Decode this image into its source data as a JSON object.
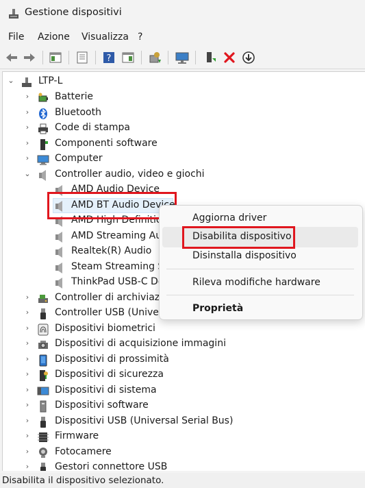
{
  "window": {
    "title": "Gestione dispositivi"
  },
  "menu": [
    "File",
    "Azione",
    "Visualizza",
    "?"
  ],
  "toolbar": {
    "buttons": [
      "back-arrow-icon",
      "forward-arrow-icon",
      "show-hide-console-tree-icon",
      "properties-icon",
      "help-icon",
      "action-pane-icon",
      "update-driver-icon",
      "scan-hardware-icon",
      "add-device-icon",
      "uninstall-device-icon",
      "disable-device-icon"
    ]
  },
  "tree": {
    "root": "LTP-L",
    "categories": [
      {
        "label": "Batterie",
        "icon": "battery-icon",
        "expanded": false
      },
      {
        "label": "Bluetooth",
        "icon": "bluetooth-icon",
        "expanded": false
      },
      {
        "label": "Code di stampa",
        "icon": "printer-icon",
        "expanded": false
      },
      {
        "label": "Componenti software",
        "icon": "software-component-icon",
        "expanded": false
      },
      {
        "label": "Computer",
        "icon": "computer-icon",
        "expanded": false
      },
      {
        "label": "Controller audio, video e giochi",
        "icon": "speaker-icon",
        "expanded": true,
        "children": [
          {
            "label": "AMD Audio Device",
            "icon": "speaker-icon"
          },
          {
            "label": "AMD BT Audio Device",
            "icon": "speaker-icon",
            "selected": true
          },
          {
            "label": "AMD High Definition",
            "icon": "speaker-icon"
          },
          {
            "label": "AMD Streaming Aud",
            "icon": "speaker-icon"
          },
          {
            "label": "Realtek(R) Audio",
            "icon": "speaker-icon"
          },
          {
            "label": "Steam Streaming Sp",
            "icon": "speaker-icon"
          },
          {
            "label": "ThinkPad USB-C Doc",
            "icon": "speaker-icon"
          }
        ]
      },
      {
        "label": "Controller di archiviazio",
        "icon": "storage-controller-icon",
        "expanded": false
      },
      {
        "label": "Controller USB (Universa",
        "icon": "usb-icon",
        "expanded": false
      },
      {
        "label": "Dispositivi biometrici",
        "icon": "fingerprint-icon",
        "expanded": false
      },
      {
        "label": "Dispositivi di acquisizione immagini",
        "icon": "camera-scanner-icon",
        "expanded": false
      },
      {
        "label": "Dispositivi di prossimità",
        "icon": "proximity-icon",
        "expanded": false
      },
      {
        "label": "Dispositivi di sicurezza",
        "icon": "security-device-icon",
        "expanded": false
      },
      {
        "label": "Dispositivi di sistema",
        "icon": "system-device-icon",
        "expanded": false
      },
      {
        "label": "Dispositivi software",
        "icon": "software-device-icon",
        "expanded": false
      },
      {
        "label": "Dispositivi USB (Universal Serial Bus)",
        "icon": "usb-icon",
        "expanded": false
      },
      {
        "label": "Firmware",
        "icon": "firmware-icon",
        "expanded": false
      },
      {
        "label": "Fotocamere",
        "icon": "webcam-icon",
        "expanded": false
      },
      {
        "label": "Gestori connettore USB",
        "icon": "usb-icon",
        "expanded": false
      }
    ]
  },
  "context_menu": {
    "items": [
      "Aggiorna driver",
      "Disabilita dispositivo",
      "Disinstalla dispositivo",
      "Rileva modifiche hardware",
      "Proprietà"
    ],
    "highlighted": "Disabilita dispositivo"
  },
  "status": {
    "text": "Disabilita il dispositivo selezionato."
  },
  "colors": {
    "highlight_box": "#e0161e",
    "selection": "#e5f1fb",
    "accent": "#0067c0"
  }
}
